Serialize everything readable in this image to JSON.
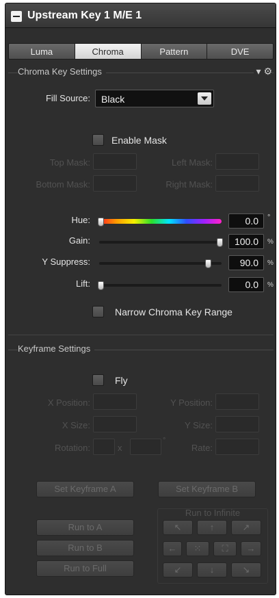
{
  "window": {
    "title": "Upstream Key 1 M/E 1"
  },
  "tabs": [
    {
      "label": "Luma",
      "active": false
    },
    {
      "label": "Chroma",
      "active": true
    },
    {
      "label": "Pattern",
      "active": false
    },
    {
      "label": "DVE",
      "active": false
    }
  ],
  "chroma": {
    "section_title": "Chroma Key Settings",
    "settings_icon": "gear-icon",
    "fill_source": {
      "label": "Fill Source:",
      "value": "Black"
    },
    "enable_mask": {
      "label": "Enable Mask",
      "checked": false
    },
    "mask": {
      "top_label": "Top Mask:",
      "bottom_label": "Bottom Mask:",
      "left_label": "Left Mask:",
      "right_label": "Right Mask:"
    },
    "hue": {
      "label": "Hue:",
      "value": "0.0",
      "unit": "°",
      "level": 0.0
    },
    "gain": {
      "label": "Gain:",
      "value": "100.0",
      "unit": "%",
      "level": 1.0
    },
    "y_suppress": {
      "label": "Y Suppress:",
      "value": "90.0",
      "unit": "%",
      "level": 0.9
    },
    "lift": {
      "label": "Lift:",
      "value": "0.0",
      "unit": "%",
      "level": 0.0
    },
    "narrow_range": {
      "label": "Narrow Chroma Key Range",
      "checked": false
    }
  },
  "keyframe": {
    "section_title": "Keyframe Settings",
    "fly": {
      "label": "Fly",
      "checked": false
    },
    "x_position_label": "X Position:",
    "y_position_label": "Y Position:",
    "x_size_label": "X Size:",
    "y_size_label": "Y Size:",
    "rotation_label": "Rotation:",
    "rotation_x": "x",
    "rotation_unit": "°",
    "rate_label": "Rate:",
    "set_a": "Set Keyframe A",
    "set_b": "Set Keyframe B",
    "run_a": "Run to A",
    "run_b": "Run to B",
    "run_full": "Run to Full",
    "run_infinite_title": "Run to Infinite",
    "infinite_buttons": [
      "↖",
      "↑",
      "↗",
      "←",
      "⁙",
      "⛶",
      "→",
      "↙",
      "↓",
      "↘"
    ]
  }
}
